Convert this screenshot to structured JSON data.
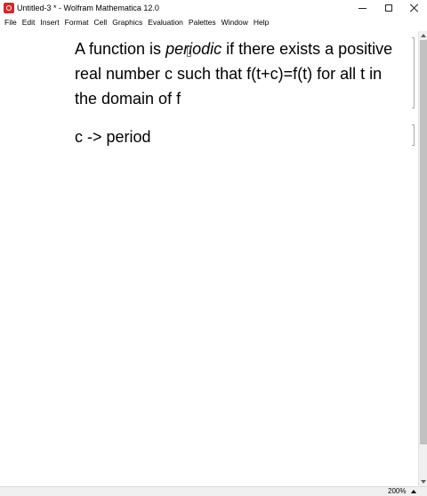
{
  "window": {
    "title": "Untitled-3 * - Wolfram Mathematica 12.0"
  },
  "menu": [
    "File",
    "Edit",
    "Insert",
    "Format",
    "Cell",
    "Graphics",
    "Evaluation",
    "Palettes",
    "Window",
    "Help"
  ],
  "notebook": {
    "cell1": {
      "before": "A function is ",
      "italic": "periodic",
      "after": " if there exists a positive real number c such that f(t+c)=f(t) for all t in the domain of f"
    },
    "cell2": {
      "text": "c -> period"
    }
  },
  "status": {
    "zoom": "200%"
  },
  "colors": {
    "app_icon": "#d8262b",
    "scrollbar_thumb": "#c1c1c1"
  }
}
